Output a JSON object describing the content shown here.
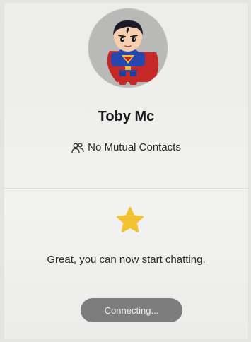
{
  "profile": {
    "name": "Toby Mc",
    "mutual_contacts": "No Mutual Contacts",
    "mutual_icon": "people-icon",
    "avatar_icon": "superhero-avatar"
  },
  "chat": {
    "star_icon": "star-icon",
    "message": "Great, you can now start chatting.",
    "connecting_label": "Connecting..."
  },
  "colors": {
    "star": "#f2c230",
    "button_bg": "#7d7d7d",
    "text": "#2a2a2a"
  }
}
